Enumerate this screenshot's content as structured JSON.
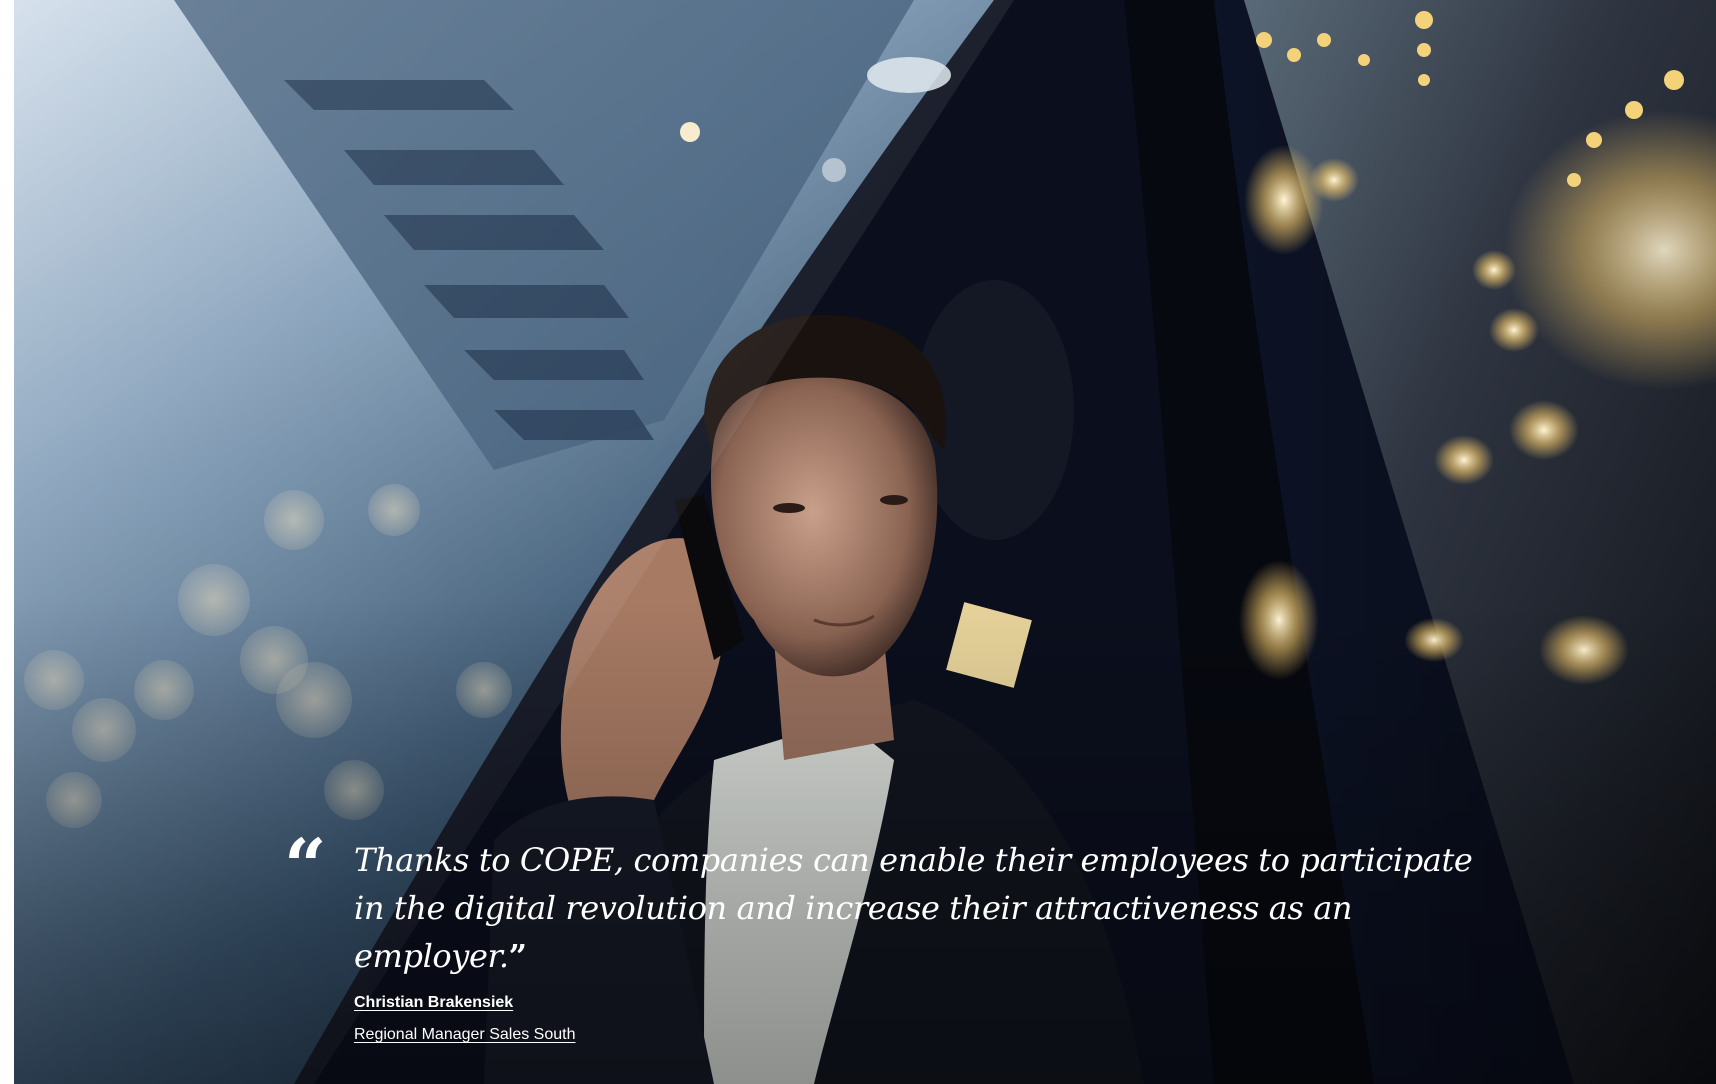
{
  "testimonial": {
    "quote_mark": "“",
    "quote": "Thanks to COPE, companies can enable their employees to participate in the digital revolution and increase their attractiveness as an employer.",
    "close_mark": "”",
    "author_name": "Christian Brakensiek",
    "author_role": "Regional Manager Sales South"
  }
}
